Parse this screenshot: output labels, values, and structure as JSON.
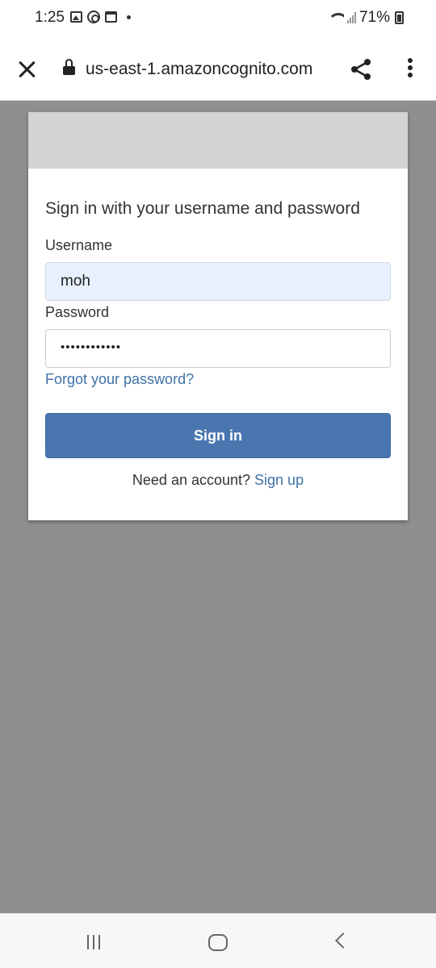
{
  "status_bar": {
    "time": "1:25",
    "battery": "71%"
  },
  "browser": {
    "url": "us-east-1.amazoncognito.com"
  },
  "form": {
    "title": "Sign in with your username and password",
    "username_label": "Username",
    "username_value": "moh",
    "password_label": "Password",
    "password_value": "••••••••••••",
    "forgot_link": "Forgot your password?",
    "signin_button": "Sign in",
    "signup_prompt": "Need an account? ",
    "signup_link": "Sign up"
  },
  "colors": {
    "primary_button": "#4a76b0",
    "link": "#3f72a8",
    "autofill_bg": "#e8f0fe",
    "backdrop": "#8e8e8e"
  },
  "icons": [
    "image-icon",
    "clock-icon",
    "calendar-icon",
    "wifi-icon",
    "signal-icon",
    "battery-icon",
    "close-icon",
    "lock-icon",
    "share-icon",
    "more-vert-icon",
    "recents-icon",
    "home-icon",
    "back-icon"
  ]
}
